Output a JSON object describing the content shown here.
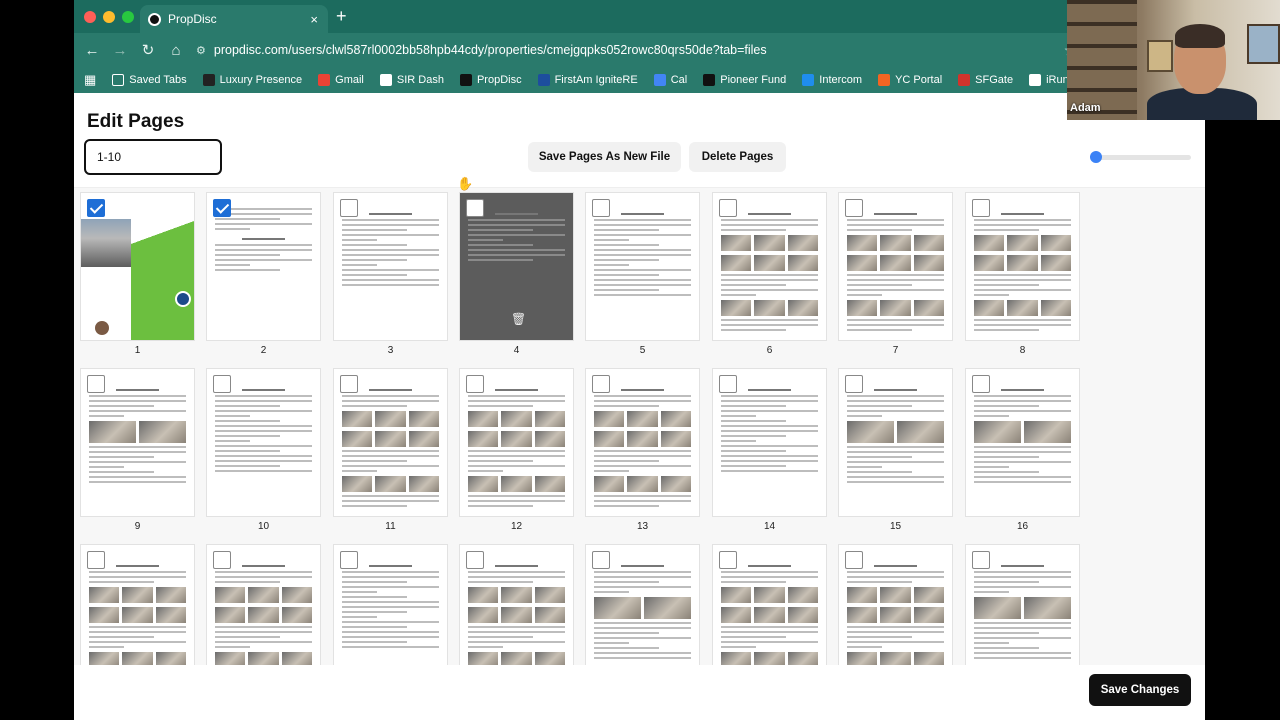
{
  "browser": {
    "tab_title": "PropDisc",
    "tab_close": "×",
    "new_tab": "+",
    "url": "propdisc.com/users/clwl587rl0002bb58hpb44cdy/properties/cmejgqpks052rowc80qrs50de?tab=files"
  },
  "bookmarks": [
    {
      "label": "Saved Tabs",
      "icon": "folder-icon",
      "color": "#ffffff"
    },
    {
      "label": "Luxury Presence",
      "icon": "luxury-presence-icon",
      "color": "#222222"
    },
    {
      "label": "Gmail",
      "icon": "gmail-icon",
      "color": "#ea4335"
    },
    {
      "label": "SIR Dash",
      "icon": "sir-dash-icon",
      "color": "#ffffff"
    },
    {
      "label": "PropDisc",
      "icon": "propdisc-icon",
      "color": "#111111"
    },
    {
      "label": "FirstAm IgniteRE",
      "icon": "firstam-icon",
      "color": "#1d4e9e"
    },
    {
      "label": "Cal",
      "icon": "calendar-icon",
      "color": "#4285f4"
    },
    {
      "label": "Pioneer Fund",
      "icon": "pioneer-fund-icon",
      "color": "#111111"
    },
    {
      "label": "Intercom",
      "icon": "intercom-icon",
      "color": "#1f8ded"
    },
    {
      "label": "YC Portal",
      "icon": "yc-icon",
      "color": "#f26522"
    },
    {
      "label": "SFGate",
      "icon": "sfgate-icon",
      "color": "#d0342c"
    },
    {
      "label": "iRunFar",
      "icon": "irunfar-icon",
      "color": "#ffffff"
    }
  ],
  "app": {
    "title": "Edit Pages",
    "range_value": "1-10",
    "save_new_label": "Save Pages As New File",
    "delete_label": "Delete Pages",
    "save_changes_label": "Save Changes",
    "zoom_fraction": 0
  },
  "pages": [
    {
      "num": "1",
      "checked": true,
      "style": "cover"
    },
    {
      "num": "2",
      "checked": true,
      "style": "letter"
    },
    {
      "num": "3",
      "checked": false,
      "style": "toc"
    },
    {
      "num": "4",
      "checked": false,
      "style": "hovered"
    },
    {
      "num": "5",
      "checked": false,
      "style": "text"
    },
    {
      "num": "6",
      "checked": false,
      "style": "photos"
    },
    {
      "num": "7",
      "checked": false,
      "style": "photos"
    },
    {
      "num": "8",
      "checked": false,
      "style": "photos"
    },
    {
      "num": "9",
      "checked": false,
      "style": "mixed"
    },
    {
      "num": "10",
      "checked": false,
      "style": "text"
    },
    {
      "num": "11",
      "checked": false,
      "style": "photos"
    },
    {
      "num": "12",
      "checked": false,
      "style": "photos"
    },
    {
      "num": "13",
      "checked": false,
      "style": "photos"
    },
    {
      "num": "14",
      "checked": false,
      "style": "text"
    },
    {
      "num": "15",
      "checked": false,
      "style": "mixed"
    },
    {
      "num": "16",
      "checked": false,
      "style": "mixed"
    },
    {
      "num": "",
      "checked": false,
      "style": "photos"
    },
    {
      "num": "",
      "checked": false,
      "style": "photos"
    },
    {
      "num": "",
      "checked": false,
      "style": "text"
    },
    {
      "num": "",
      "checked": false,
      "style": "photos"
    },
    {
      "num": "",
      "checked": false,
      "style": "mixed"
    },
    {
      "num": "",
      "checked": false,
      "style": "photos"
    },
    {
      "num": "",
      "checked": false,
      "style": "photos"
    },
    {
      "num": "",
      "checked": false,
      "style": "mixed"
    }
  ],
  "webcam": {
    "name": "Adam"
  }
}
